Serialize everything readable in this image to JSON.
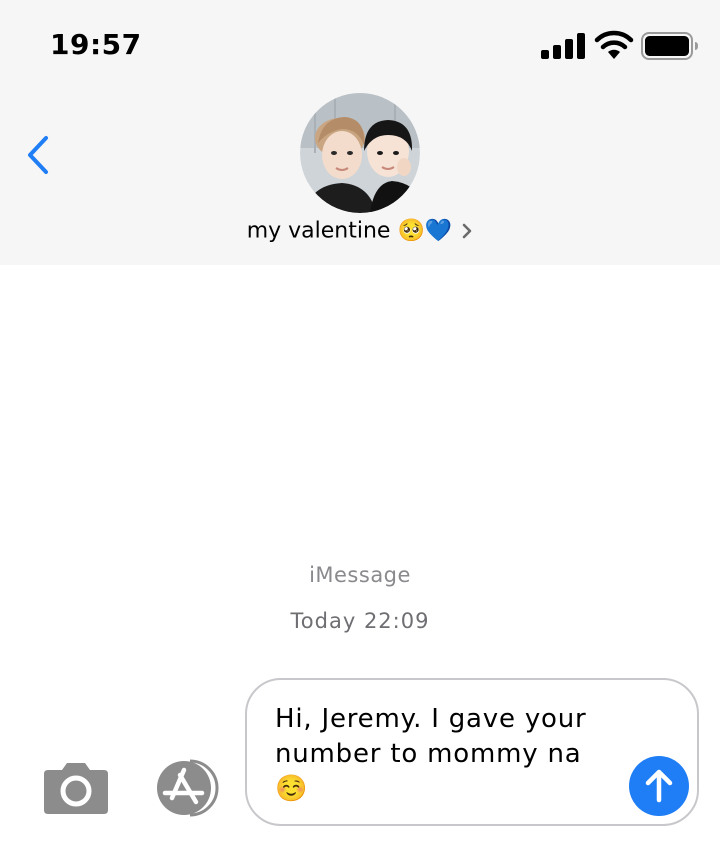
{
  "status_bar": {
    "time": "19:57",
    "icons": [
      "signal-icon",
      "wifi-icon",
      "battery-icon"
    ]
  },
  "header": {
    "back_icon": "chevron-left-icon",
    "contact_name": "my valentine",
    "contact_emoji": "🥺💙",
    "accent_color": "#1f7ef5"
  },
  "conversation": {
    "service": "iMessage",
    "timestamp": "Today 22:09"
  },
  "compose": {
    "text": "Hi, Jeremy. I gave your\nnumber to mommy na\n☺️",
    "camera_icon": "camera-icon",
    "apps_icon": "app-store-icon",
    "send_icon": "send-arrow-up-icon",
    "send_color": "#1f7ef5"
  }
}
